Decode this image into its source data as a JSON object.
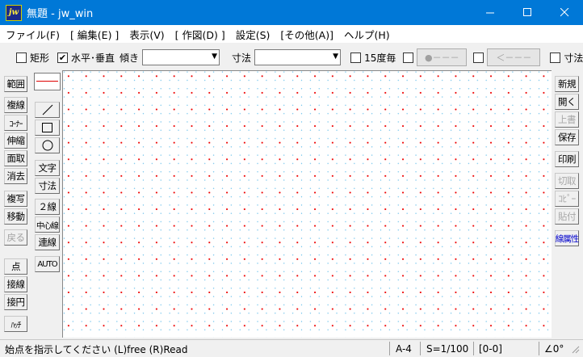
{
  "window": {
    "icon_text": "jw",
    "title": "無題 - jw_win"
  },
  "menu": [
    "ファイル(F)",
    "[ 編集(E) ]",
    "表示(V)",
    "[ 作図(D) ]",
    "設定(S)",
    "[その他(A)]",
    "ヘルプ(H)"
  ],
  "toolbar": {
    "rect_label": "矩形",
    "rect_checked": false,
    "hv_label": "水平･垂直",
    "hv_checked": true,
    "tilt_label": "傾き",
    "tilt_value": "",
    "dim_label": "寸法",
    "dim_value": "",
    "deg15_label": "15度毎",
    "deg15_checked": false,
    "dot_button_label": "●－－－",
    "arrow_button_label": "＜－－－",
    "dim2_label": "寸法"
  },
  "left_tools": {
    "col1": [
      "範囲",
      "複線",
      "ｺｰﾅｰ",
      "伸縮",
      "面取",
      "消去",
      "複写",
      "移動",
      "戻る",
      "点",
      "接線",
      "接円",
      "ﾊｯﾁ"
    ],
    "col2": [
      "／",
      "□",
      "○",
      "文字",
      "寸法",
      "２線",
      "中心線",
      "連線",
      "AUTO"
    ]
  },
  "right_tools": [
    "新規",
    "開く",
    "上書",
    "保存",
    "印刷",
    "切取",
    "ｺﾋﾟｰ",
    "貼付",
    "線属性"
  ],
  "status": {
    "message": "始点を指示してください (L)free (R)Read",
    "paper": "A-4",
    "scale": "S=1/100",
    "layer": "[0-0]",
    "angle": "∠0°"
  },
  "colors": {
    "titlebar": "#0078d7",
    "grid_dot": "#e00000",
    "grid_sub_dot": "#7fc9ee",
    "layer_link": "#0000cc"
  }
}
